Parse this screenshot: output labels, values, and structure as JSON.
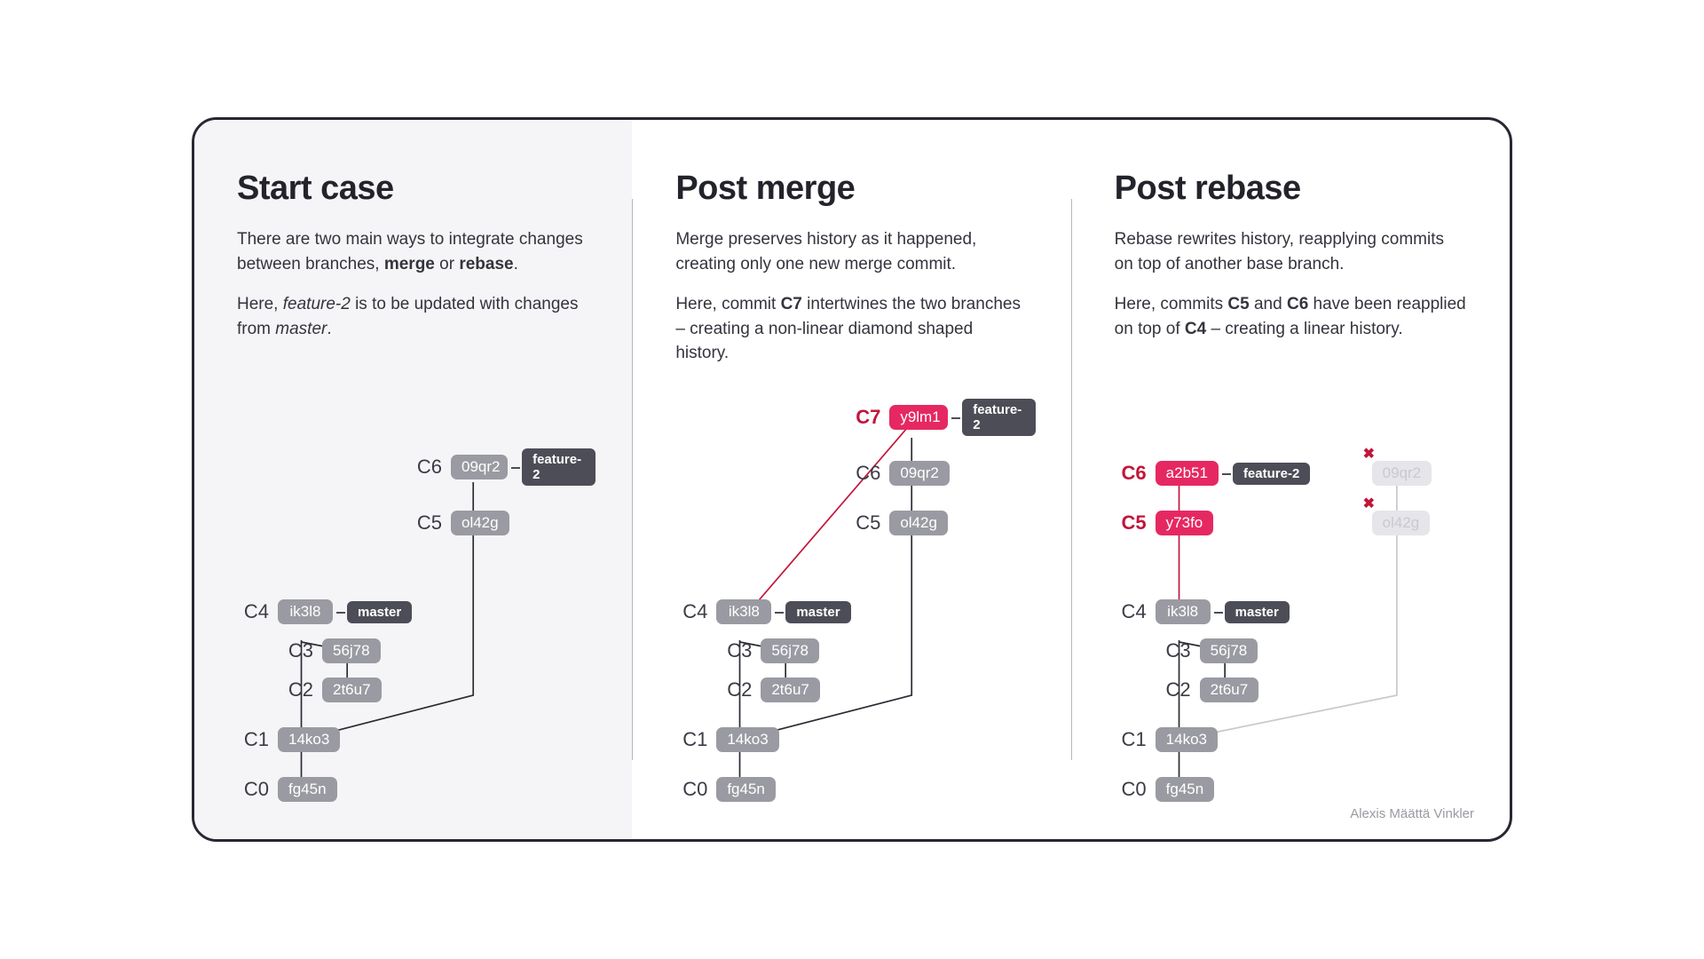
{
  "attribution": "Alexis Määttä Vinkler",
  "panels": {
    "start": {
      "title": "Start case",
      "p1_a": "There are two main ways to integrate changes between branches, ",
      "p1_b1": "merge",
      "p1_mid": " or ",
      "p1_b2": "rebase",
      "p1_end": ".",
      "p2_a": "Here, ",
      "p2_i1": "feature-2",
      "p2_mid": " is to be updated with changes from ",
      "p2_i2": "master",
      "p2_end": "."
    },
    "merge": {
      "title": "Post merge",
      "p1": "Merge preserves history as it happened, creating only one new merge commit.",
      "p2_a": "Here, commit ",
      "p2_b": "C7",
      "p2_rest": " intertwines the two branches – creating a non-linear diamond shaped history."
    },
    "rebase": {
      "title": "Post rebase",
      "p1": "Rebase rewrites history, reapplying commits on top of another base branch.",
      "p2_a": "Here, commits ",
      "p2_b1": "C5",
      "p2_mid": " and ",
      "p2_b2": "C6",
      "p2_rest": " have been reapplied on top of ",
      "p2_b3": "C4",
      "p2_end": " – creating a linear history."
    }
  },
  "commits": {
    "c0": {
      "label": "C0",
      "sha": "fg45n"
    },
    "c1": {
      "label": "C1",
      "sha": "14ko3"
    },
    "c2": {
      "label": "C2",
      "sha": "2t6u7"
    },
    "c3": {
      "label": "C3",
      "sha": "56j78"
    },
    "c4": {
      "label": "C4",
      "sha": "ik3l8"
    },
    "c5": {
      "label": "C5",
      "sha": "ol42g"
    },
    "c6": {
      "label": "C6",
      "sha": "09qr2"
    },
    "c7": {
      "label": "C7",
      "sha": "y9lm1"
    },
    "c5r": {
      "label": "C5",
      "sha": "y73fo"
    },
    "c6r": {
      "label": "C6",
      "sha": "a2b51"
    }
  },
  "branches": {
    "master": "master",
    "feature2": "feature-2"
  }
}
